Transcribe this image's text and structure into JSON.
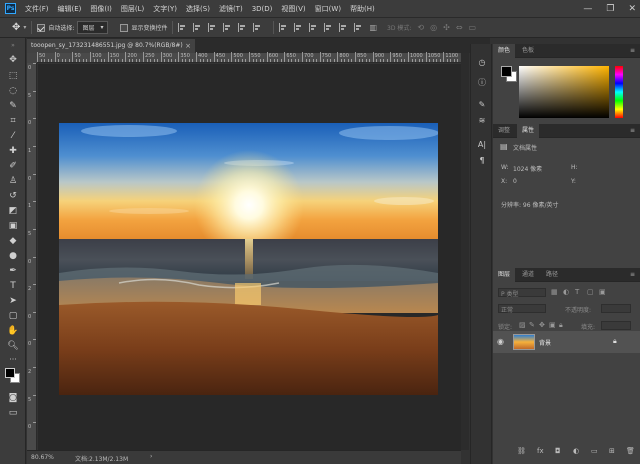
{
  "menubar": {
    "logo": "Ps",
    "items": [
      "文件(F)",
      "编辑(E)",
      "图像(I)",
      "图层(L)",
      "文字(Y)",
      "选择(S)",
      "滤镜(T)",
      "3D(D)",
      "视图(V)",
      "窗口(W)",
      "帮助(H)"
    ],
    "minimize": "—",
    "maximize": "❐",
    "close": "✕"
  },
  "options": {
    "auto_select_label": "自动选择:",
    "auto_select_value": "图层",
    "show_transform_label": "显示变换控件",
    "mode_3d_label": "3D 模式:"
  },
  "document": {
    "tab_title": "tooopen_sy_173231486551.jpg @ 80.7%(RGB/8#)",
    "close": "×"
  },
  "ruler": {
    "top_numbers": [
      "50",
      "0",
      "50",
      "100",
      "150",
      "200",
      "250",
      "300",
      "350",
      "400",
      "450",
      "500",
      "550",
      "600",
      "650",
      "700",
      "750",
      "800",
      "850",
      "900",
      "950",
      "1000",
      "1050",
      "1100"
    ],
    "left_numbers": [
      "0",
      "5",
      "0",
      "1",
      "0",
      "1",
      "5",
      "0",
      "2",
      "0",
      "0",
      "2",
      "5",
      "0"
    ]
  },
  "statusbar": {
    "zoom": "80.67%",
    "doc_info": "文档:2.13M/2.13M",
    "arrow": "›"
  },
  "panels": {
    "color": {
      "tabs": [
        "颜色",
        "色板"
      ],
      "active": 0
    },
    "properties": {
      "tabs": [
        "调整",
        "属性"
      ],
      "active": 1,
      "title": "文档属性",
      "w_label": "W:",
      "w_value": "1024 像素",
      "h_label": "H:",
      "x_label": "X:",
      "x_value": "0",
      "y_label": "Y:",
      "resolution": "分辨率: 96 像素/英寸"
    },
    "layers": {
      "tabs": [
        "图层",
        "通道",
        "路径"
      ],
      "active": 0,
      "search_placeholder": "P 类型",
      "blend_mode": "正常",
      "opacity_label": "不透明度:",
      "lock_label": "锁定:",
      "fill_label": "填充:",
      "layer_name": "背景"
    }
  },
  "colors": {
    "fg": "#000000",
    "bg": "#ffffff",
    "picker_hue": "#ffb400"
  }
}
